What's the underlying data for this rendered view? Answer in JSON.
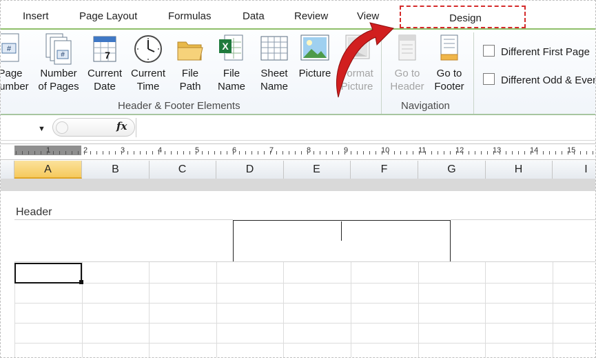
{
  "tabs": {
    "insert": "Insert",
    "page_layout": "Page Layout",
    "formulas": "Formulas",
    "data": "Data",
    "review": "Review",
    "view": "View",
    "design": "Design"
  },
  "ribbon": {
    "header_footer_elements": {
      "label": "Header & Footer Elements",
      "buttons": [
        {
          "line1": "Page",
          "line2": "Number",
          "icon": "page-number-icon"
        },
        {
          "line1": "Number",
          "line2": "of Pages",
          "icon": "number-of-pages-icon"
        },
        {
          "line1": "Current",
          "line2": "Date",
          "icon": "calendar-icon"
        },
        {
          "line1": "Current",
          "line2": "Time",
          "icon": "clock-icon"
        },
        {
          "line1": "File",
          "line2": "Path",
          "icon": "folder-icon"
        },
        {
          "line1": "File",
          "line2": "Name",
          "icon": "excel-file-icon"
        },
        {
          "line1": "Sheet",
          "line2": "Name",
          "icon": "sheet-icon"
        },
        {
          "line1": "Picture",
          "line2": "",
          "icon": "picture-icon"
        },
        {
          "line1": "Format",
          "line2": "Picture",
          "icon": "format-picture-icon"
        }
      ]
    },
    "navigation": {
      "label": "Navigation",
      "go_to_header": {
        "line1": "Go to",
        "line2": "Header"
      },
      "go_to_footer": {
        "line1": "Go to",
        "line2": "Footer"
      }
    },
    "options": {
      "different_first_page": "Different First Page",
      "different_odd_even": "Different Odd & Even Pages"
    }
  },
  "formula_bar": {
    "fx_label": "fx"
  },
  "ruler": {
    "numbers": [
      "1",
      "2",
      "3",
      "4",
      "5",
      "6",
      "7",
      "8",
      "9",
      "10",
      "11",
      "12",
      "13",
      "14",
      "15"
    ]
  },
  "columns": [
    "A",
    "B",
    "C",
    "D",
    "E",
    "F",
    "G",
    "H",
    "I"
  ],
  "selected_column": "A",
  "page": {
    "header_label": "Header"
  },
  "colors": {
    "accent_red": "#d42a2a",
    "selected_column": "#f6c95d",
    "ribbon_border": "#8fbf6a"
  }
}
